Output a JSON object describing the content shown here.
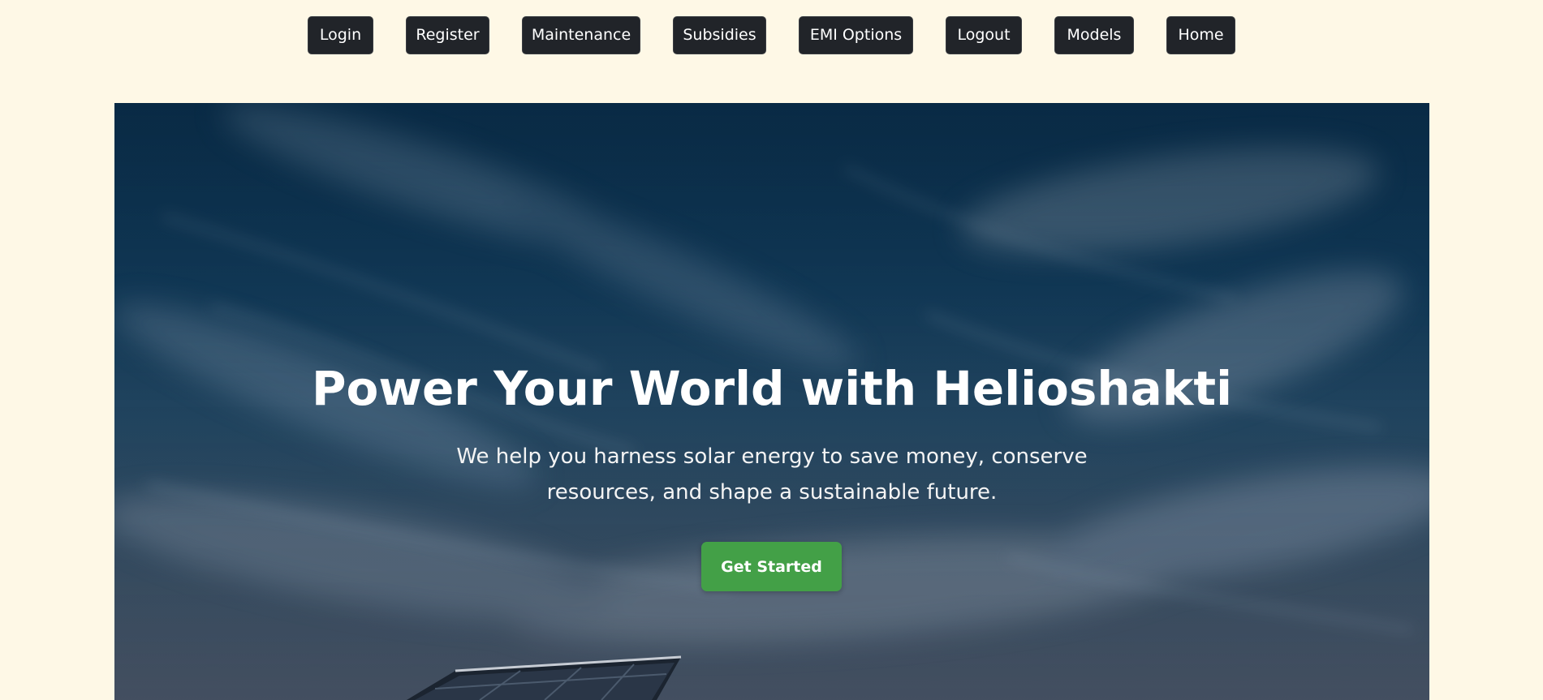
{
  "nav": {
    "items": [
      {
        "label": "Login"
      },
      {
        "label": "Register"
      },
      {
        "label": "Maintenance"
      },
      {
        "label": "Subsidies"
      },
      {
        "label": "EMI Options"
      },
      {
        "label": "Logout"
      },
      {
        "label": "Models"
      },
      {
        "label": "Home"
      }
    ]
  },
  "hero": {
    "title": "Power Your World with Helioshakti",
    "subtitle": "We help you harness solar energy to save money, conserve resources, and shape a sustainable future.",
    "cta_label": "Get Started"
  },
  "colors": {
    "page_background": "#fef8e6",
    "nav_button": "#212429",
    "cta_button": "#43a047",
    "hero_sky": "#0b2f4b"
  }
}
